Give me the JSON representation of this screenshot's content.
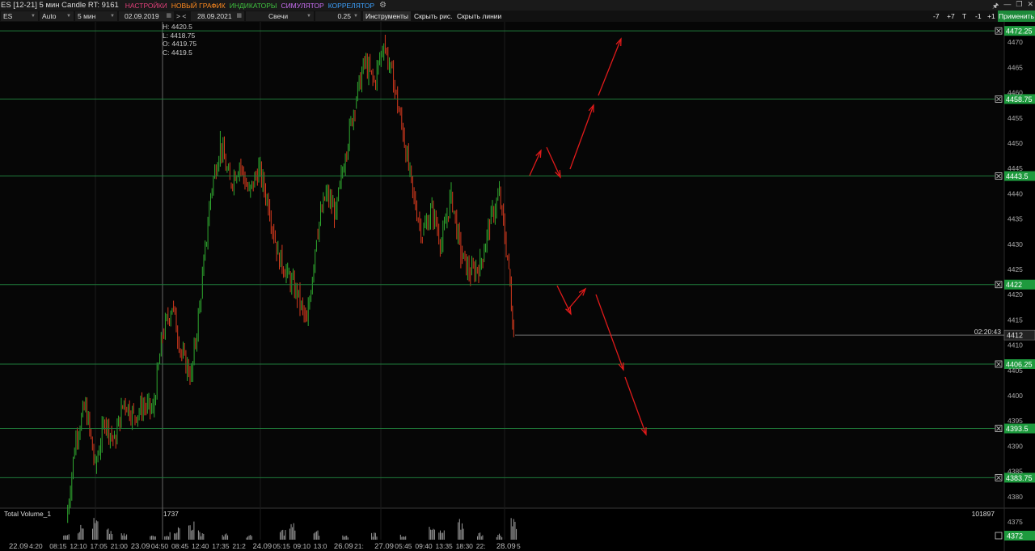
{
  "window": {
    "title": "ES [12-21] 5 мин Candle RT: 9161",
    "menus": [
      {
        "label": "НАСТРОЙКИ",
        "color": "#e0407a"
      },
      {
        "label": "НОВЫЙ ГРАФИК",
        "color": "#ff8a1e"
      },
      {
        "label": "ИНДИКАТОРЫ",
        "color": "#3fc23f"
      },
      {
        "label": "СИМУЛЯТОР",
        "color": "#c76ef0"
      },
      {
        "label": "КОРРЕЛЯТОР",
        "color": "#3da2ff"
      }
    ],
    "gear_icon": "gear-icon",
    "controls": [
      "🖈",
      "—",
      "❐",
      "✕"
    ]
  },
  "toolbar": {
    "symbol": "ES",
    "scale": "Auto",
    "timeframe": "5 мин",
    "date_from": "02.09.2019",
    "nav_prev": "> <",
    "date_to": "28.09.2021",
    "chart_type": "Свечи",
    "tick": "0.25",
    "tools_label": "Инструменты",
    "hide_drawings_label": "Скрыть рис.",
    "hide_lines_label": "Скрыть линии",
    "btn_minus7": "-7",
    "btn_plus7": "+7",
    "btn_t": "T",
    "btn_minus1": "-1",
    "btn_plus1": "+1",
    "apply_label": "Применить"
  },
  "crosshair": {
    "h": "H: 4420.5",
    "l": "L: 4418.75",
    "o": "O: 4419.75",
    "c": "C: 4419.5"
  },
  "price_axis": {
    "ticks": [
      4470,
      4465,
      4460,
      4455,
      4450,
      4445,
      4440,
      4435,
      4430,
      4425,
      4420,
      4415,
      4410,
      4405,
      4400,
      4395,
      4390,
      4385,
      4380,
      4375
    ],
    "levels": [
      "4472.25",
      "4458.75",
      "4443.5",
      "4422",
      "4406.25",
      "4393.5",
      "4383.75"
    ],
    "last_price": "4412",
    "timer": "02:20:43",
    "volume_axis_label": "4372"
  },
  "volume": {
    "title": "Total Volume_1",
    "value": "1737",
    "max": "101897"
  },
  "time_axis": [
    "22.09",
    "4:20",
    "08:15",
    "12:10",
    "17:05",
    "21:00",
    "23.09",
    "04:50",
    "08:45",
    "12:40",
    "17:35",
    "21:2",
    "24.09",
    "05:15",
    "09:10",
    "13:0",
    "26.09",
    "21:",
    "27.09",
    "05:45",
    "09:40",
    "13:35",
    "18:30",
    "22:",
    "28.09",
    "5"
  ],
  "colors": {
    "bull": "#2fa82f",
    "bear": "#d63a1e",
    "level_line": "#1f7a3a",
    "level_box": "#1e9a3e",
    "arrow": "#e01a1a",
    "background": "#000000"
  },
  "chart_data": {
    "type": "candlestick",
    "instrument": "ES [12-21]",
    "interval": "5 мин",
    "ylim": [
      4372,
      4474
    ],
    "horizontal_levels": [
      4472.25,
      4458.75,
      4443.5,
      4422,
      4406.25,
      4393.5,
      4383.75
    ],
    "last_price": 4412,
    "close_path": [
      [
        0,
        4375
      ],
      [
        2,
        4392
      ],
      [
        4,
        4398
      ],
      [
        6,
        4386
      ],
      [
        8,
        4395
      ],
      [
        10,
        4391
      ],
      [
        12,
        4399
      ],
      [
        14,
        4396
      ],
      [
        16,
        4398
      ],
      [
        18,
        4397
      ],
      [
        20,
        4412
      ],
      [
        22,
        4418
      ],
      [
        24,
        4408
      ],
      [
        26,
        4404
      ],
      [
        28,
        4420
      ],
      [
        30,
        4440
      ],
      [
        32,
        4450
      ],
      [
        34,
        4442
      ],
      [
        36,
        4446
      ],
      [
        38,
        4440
      ],
      [
        40,
        4445
      ],
      [
        42,
        4438
      ],
      [
        44,
        4428
      ],
      [
        46,
        4424
      ],
      [
        48,
        4420
      ],
      [
        50,
        4414
      ],
      [
        52,
        4432
      ],
      [
        54,
        4440
      ],
      [
        56,
        4436
      ],
      [
        58,
        4448
      ],
      [
        60,
        4458
      ],
      [
        62,
        4466
      ],
      [
        64,
        4462
      ],
      [
        66,
        4470
      ],
      [
        68,
        4462
      ],
      [
        70,
        4452
      ],
      [
        72,
        4440
      ],
      [
        74,
        4432
      ],
      [
        76,
        4437
      ],
      [
        78,
        4430
      ],
      [
        80,
        4440
      ],
      [
        82,
        4428
      ],
      [
        84,
        4424
      ],
      [
        86,
        4426
      ],
      [
        88,
        4434
      ],
      [
        90,
        4440
      ],
      [
        92,
        4425
      ],
      [
        93,
        4412
      ]
    ],
    "volume_series": [
      [
        0,
        12
      ],
      [
        3,
        20
      ],
      [
        6,
        28
      ],
      [
        9,
        14
      ],
      [
        12,
        8
      ],
      [
        18,
        6
      ],
      [
        21,
        10
      ],
      [
        23,
        18
      ],
      [
        26,
        26
      ],
      [
        28,
        12
      ],
      [
        33,
        8
      ],
      [
        38,
        6
      ],
      [
        45,
        14
      ],
      [
        47,
        22
      ],
      [
        52,
        12
      ],
      [
        58,
        6
      ],
      [
        64,
        10
      ],
      [
        70,
        8
      ],
      [
        76,
        16
      ],
      [
        78,
        12
      ],
      [
        82,
        26
      ],
      [
        86,
        10
      ],
      [
        90,
        8
      ],
      [
        93,
        30
      ]
    ]
  }
}
